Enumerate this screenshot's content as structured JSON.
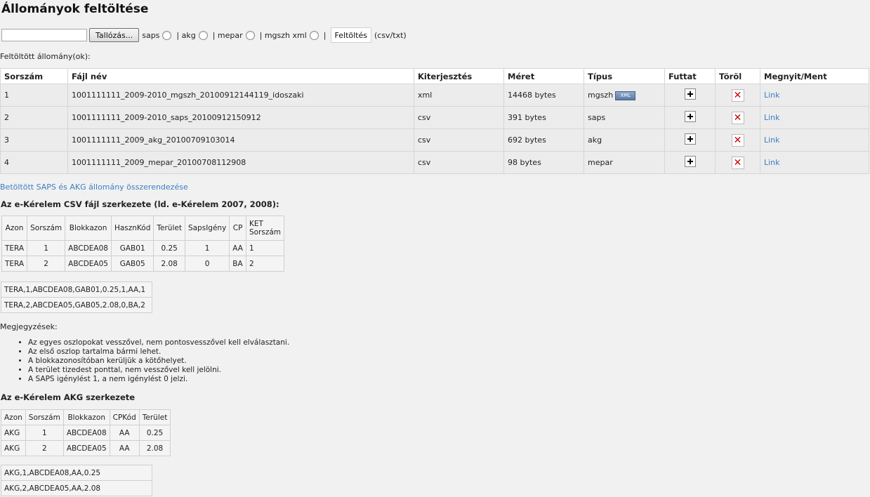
{
  "page_title": "Állományok feltöltése",
  "upload": {
    "browse_label": "Tallózás...",
    "options": [
      "saps",
      "| akg",
      "| mepar",
      "| mgszh xml"
    ],
    "separator": "|",
    "submit_label": "Feltöltés",
    "hint": "(csv/txt)"
  },
  "uploaded_label": "Feltöltött állomány(ok):",
  "files_table": {
    "headers": [
      "Sorszám",
      "Fájl név",
      "Kiterjesztés",
      "Méret",
      "Típus",
      "Futtat",
      "Töröl",
      "Megnyit/Ment"
    ],
    "rows": [
      {
        "num": "1",
        "name": "1001111111_2009-2010_mgszh_20100912144119_idoszaki",
        "ext": "xml",
        "size": "14468 bytes",
        "type": "mgszh",
        "badge": "XML",
        "link": "Link"
      },
      {
        "num": "2",
        "name": "1001111111_2009-2010_saps_20100912150912",
        "ext": "csv",
        "size": "391 bytes",
        "type": "saps",
        "link": "Link"
      },
      {
        "num": "3",
        "name": "1001111111_2009_akg_20100709103014",
        "ext": "csv",
        "size": "692 bytes",
        "type": "akg",
        "link": "Link"
      },
      {
        "num": "4",
        "name": "1001111111_2009_mepar_20100708112908",
        "ext": "csv",
        "size": "98 bytes",
        "type": "mepar",
        "link": "Link"
      }
    ]
  },
  "assoc_link": "Betöltött SAPS és AKG állomány összerendezése",
  "csv_section_title": "Az e-Kérelem CSV fájl szerkezete (ld. e-Kérelem 2007, 2008):",
  "csv_table": {
    "headers": [
      "Azon",
      "Sorszám",
      "Blokkazon",
      "HasznKód",
      "Terület",
      "SapsIgény",
      "CP",
      "KET Sorszám"
    ],
    "rows": [
      [
        "TERA",
        "1",
        "ABCDEA08",
        "GAB01",
        "0.25",
        "1",
        "AA",
        "1"
      ],
      [
        "TERA",
        "2",
        "ABCDEA05",
        "GAB05",
        "2.08",
        "0",
        "BA",
        "2"
      ]
    ]
  },
  "csv_lines": [
    "TERA,1,ABCDEA08,GAB01,0.25,1,AA,1",
    "TERA,2,ABCDEA05,GAB05,2.08,0,BA,2"
  ],
  "notes_label": "Megjegyzések:",
  "notes": [
    "Az egyes oszlopokat vesszővel, nem pontosvesszővel kell elválasztani.",
    "Az első oszlop tartalma bármi lehet.",
    "A blokkazonosítóban kerüljük a kötőhelyet.",
    "A terület tizedest ponttal, nem vesszővel kell jelölni.",
    "A SAPS igénylést 1, a nem igénylést 0 jelzi."
  ],
  "akg_section_title": "Az e-Kérelem AKG szerkezete",
  "akg_table": {
    "headers": [
      "Azon",
      "Sorszám",
      "Blokkazon",
      "CPKód",
      "Terület"
    ],
    "rows": [
      [
        "AKG",
        "1",
        "ABCDEA08",
        "AA",
        "0.25"
      ],
      [
        "AKG",
        "2",
        "ABCDEA05",
        "AA",
        "2.08"
      ]
    ]
  },
  "akg_lines": [
    "AKG,1,ABCDEA08,AA,0.25",
    "AKG,2,ABCDEA05,AA,2.08"
  ]
}
